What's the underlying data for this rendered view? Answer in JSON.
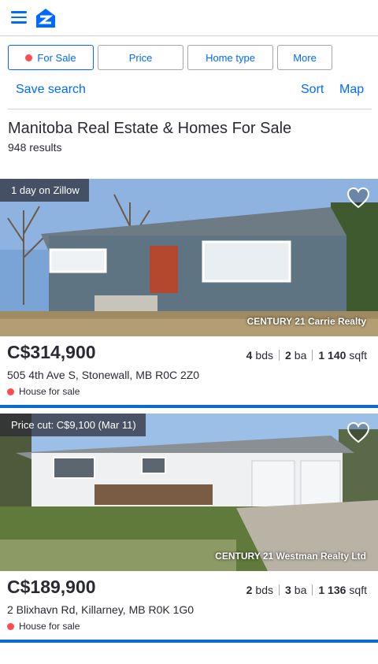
{
  "header": {
    "menu_icon": "hamburger-icon",
    "logo_icon": "zillow-logo-icon",
    "brand_color": "#006aff"
  },
  "filters": [
    {
      "label": "For Sale",
      "active": true
    },
    {
      "label": "Price"
    },
    {
      "label": "Home type"
    },
    {
      "label": "More"
    }
  ],
  "actions": {
    "save_search": "Save search",
    "sort": "Sort",
    "map": "Map"
  },
  "results": {
    "title": "Manitoba Real Estate & Homes For Sale",
    "count": "948 results"
  },
  "listings": [
    {
      "badge": "1 day on Zillow",
      "credit": "CENTURY 21 Carrie Realty",
      "price": "C$314,900",
      "beds": "4",
      "beds_unit": "bds",
      "baths": "2",
      "baths_unit": "ba",
      "sqft": "1 140",
      "sqft_unit": "sqft",
      "address": "505 4th Ave S, Stonewall, MB R0C 2Z0",
      "status": "House for sale",
      "favorite_icon": "heart-outline-icon"
    },
    {
      "badge": "Price cut: C$9,100 (Mar 11)",
      "credit": "CENTURY 21 Westman Realty Ltd",
      "price": "C$189,900",
      "beds": "2",
      "beds_unit": "bds",
      "baths": "3",
      "baths_unit": "ba",
      "sqft": "1 136",
      "sqft_unit": "sqft",
      "address": "2 Blixhavn Rd, Killarney, MB R0K 1G0",
      "status": "House for sale",
      "favorite_icon": "heart-outline-icon"
    }
  ]
}
